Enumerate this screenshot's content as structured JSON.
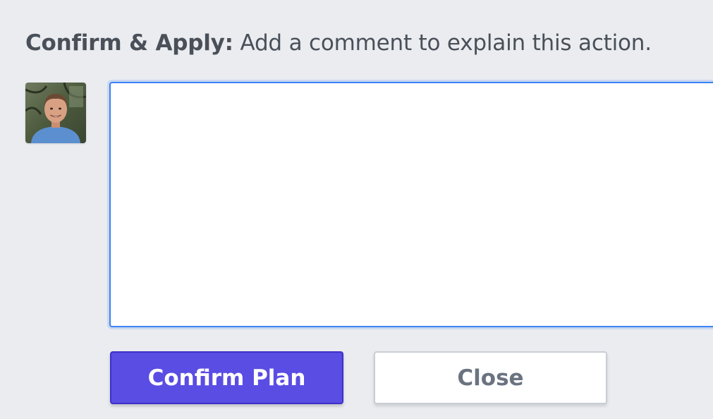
{
  "header": {
    "title_bold": "Confirm & Apply:",
    "title_rest": " Add a comment to explain this action."
  },
  "comment": {
    "value": "",
    "placeholder": ""
  },
  "actions": {
    "confirm_label": "Confirm Plan",
    "close_label": "Close"
  },
  "colors": {
    "background": "#eaecf0",
    "accent": "#5a4de3",
    "focus_border": "#3b82f6",
    "text": "#4a5059"
  },
  "icons": {
    "avatar": "user-avatar-photo"
  }
}
